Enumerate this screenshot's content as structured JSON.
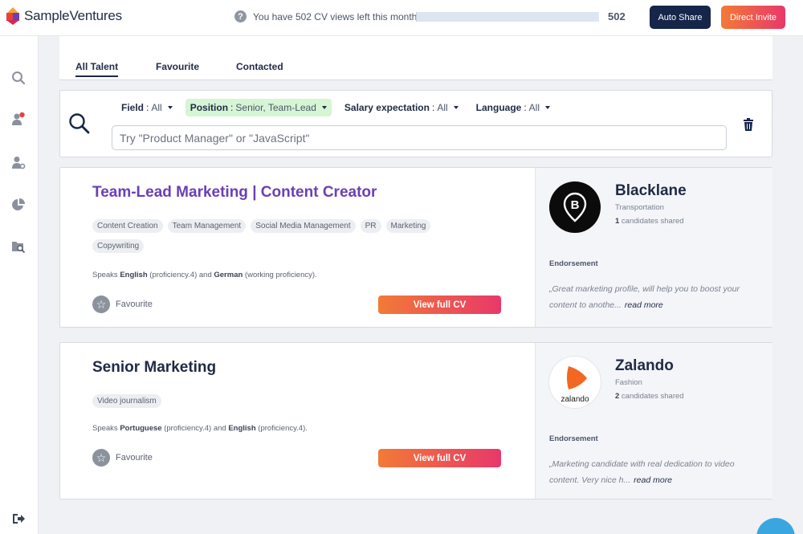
{
  "header": {
    "brand": "SampleVentures",
    "cv_views_text": "You have 502 CV views left this month",
    "cv_views_count": "502",
    "cv_views_progress": 0.99,
    "auto_share_label": "Auto Share",
    "direct_invite_label": "Direct Invite"
  },
  "sidebar": {
    "items": [
      {
        "icon": "search-icon"
      },
      {
        "icon": "user-notification-icon"
      },
      {
        "icon": "user-settings-icon"
      },
      {
        "icon": "pie-chart-icon"
      },
      {
        "icon": "folder-search-icon"
      },
      {
        "icon": "logout-icon"
      }
    ]
  },
  "tabs": [
    {
      "label": "All Talent",
      "active": true
    },
    {
      "label": "Favourite",
      "active": false
    },
    {
      "label": "Contacted",
      "active": false
    }
  ],
  "filters": [
    {
      "name": "Field",
      "value": "All"
    },
    {
      "name": "Position",
      "value": "Senior, Team-Lead",
      "highlight": true
    },
    {
      "name": "Salary expectation",
      "value": "All"
    },
    {
      "name": "Language",
      "value": "All"
    }
  ],
  "search": {
    "placeholder": "Try \"Product Manager\" or \"JavaScript\""
  },
  "cards": [
    {
      "title": "Team-Lead Marketing | Content Creator",
      "title_color": "#6a3fb5",
      "tags": [
        "Content Creation",
        "Team Management",
        "Social Media Management",
        "PR",
        "Marketing",
        "Copywriting"
      ],
      "speaks_prefix": "Speaks ",
      "lang1": "English",
      "lang1_level": " (proficiency.4) and ",
      "lang2": "German",
      "lang2_level": " (working proficiency).",
      "favourite_label": "Favourite",
      "cv_button_label": "View full CV",
      "company": {
        "name": "Blacklane",
        "industry": "Transportation",
        "shared_count": "1",
        "shared_text": " candidates shared",
        "logo_letter": "B"
      },
      "endorsement_label": "Endorsement",
      "endorsement_text": "„Great marketing profile, will help you to boost your content to anothe...",
      "read_more": "read more"
    },
    {
      "title": "Senior Marketing",
      "title_color": "#1f2a44",
      "tags": [
        "Video journalism"
      ],
      "speaks_prefix": "Speaks ",
      "lang1": "Portuguese",
      "lang1_level": " (proficiency.4) and ",
      "lang2": "English",
      "lang2_level": " (proficiency.4).",
      "favourite_label": "Favourite",
      "cv_button_label": "View full CV",
      "company": {
        "name": "Zalando",
        "industry": "Fashion",
        "shared_count": "2",
        "shared_text": " candidates shared",
        "logo_text": "zalando"
      },
      "endorsement_label": "Endorsement",
      "endorsement_text": "„Marketing candidate with real dedication to video content. Very nice h...",
      "read_more": "read more"
    }
  ]
}
